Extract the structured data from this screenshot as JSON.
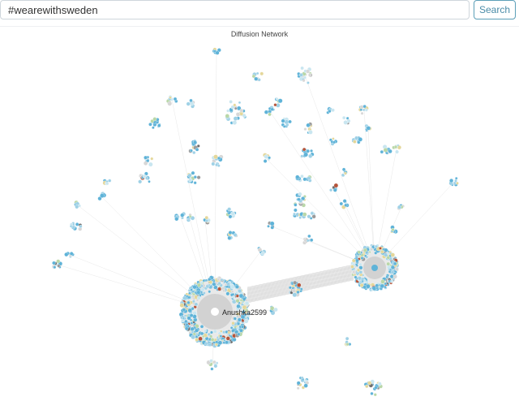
{
  "search": {
    "value": "#wearewithsweden",
    "button_label": "Search"
  },
  "network": {
    "title": "Diffusion Network",
    "hub_label": "Anushka2599",
    "node_colors": [
      "#5fb3d8",
      "#9fd1e6",
      "#c9e6f0",
      "#e4d79a",
      "#b9d7a8",
      "#d7d7d7",
      "#9a9a9a",
      "#b5543a",
      "#6e6e6e"
    ],
    "edge_color": "#b5b5b5"
  }
}
